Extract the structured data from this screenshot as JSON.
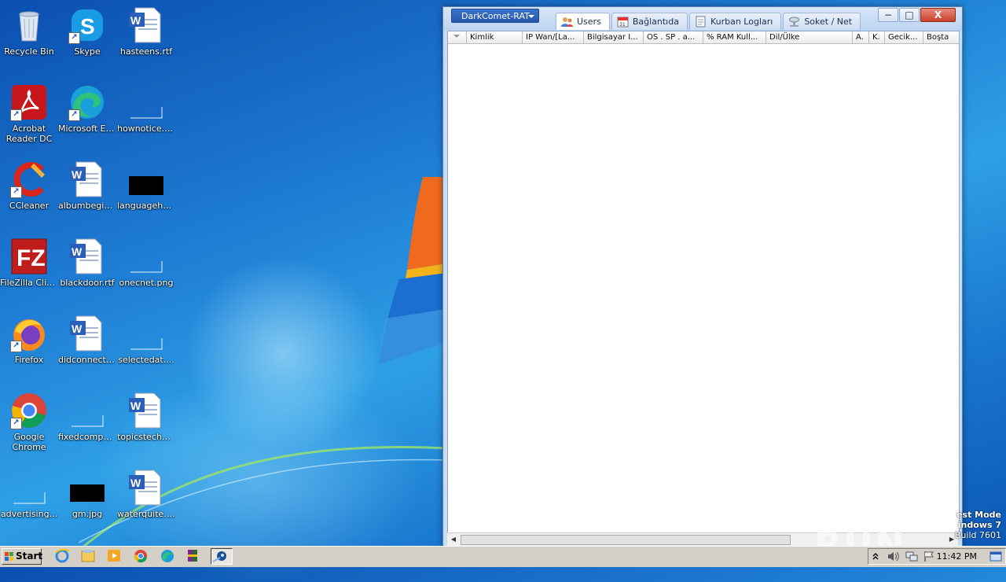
{
  "desktop": {
    "icons": [
      {
        "label": "Recycle Bin"
      },
      {
        "label": "Skype"
      },
      {
        "label": "hasteens.rtf"
      },
      {
        "label": "Acrobat Reader DC"
      },
      {
        "label": "Microsoft Edge"
      },
      {
        "label": "hownotice.png"
      },
      {
        "label": "CCleaner"
      },
      {
        "label": "albumbegin..."
      },
      {
        "label": "languagehe..."
      },
      {
        "label": "FileZilla Client"
      },
      {
        "label": "blackdoor.rtf"
      },
      {
        "label": "onecnet.png"
      },
      {
        "label": "Firefox"
      },
      {
        "label": "didconnecti..."
      },
      {
        "label": "selectedat...."
      },
      {
        "label": "Google Chrome"
      },
      {
        "label": "fixedcompa..."
      },
      {
        "label": "topicstechn..."
      },
      {
        "label": "advertising..."
      },
      {
        "label": "gm.jpg"
      },
      {
        "label": "waterquite.rtf"
      }
    ],
    "watermark": "ANY RUN",
    "test_mode": {
      "line1": "est Mode",
      "line2": "indows 7",
      "line3": "Build 7601"
    }
  },
  "window": {
    "app_menu": "DarkComet-RAT",
    "tabs": [
      {
        "label": "Users",
        "icon": "users-icon"
      },
      {
        "label": "Bağlantıda",
        "icon": "calendar-icon"
      },
      {
        "label": "Kurban Logları",
        "icon": "document-icon"
      },
      {
        "label": "Soket / Net",
        "icon": "network-icon"
      }
    ],
    "controls": {
      "minimize": "−",
      "maximize": "□",
      "close": "X"
    },
    "columns": [
      "Kimlik",
      "IP Wan/[La...",
      "Bilgisayar I...",
      "OS . SP . a...",
      "% RAM Kull...",
      "Dil/Ülke",
      "A.",
      "K.",
      "Gecik...",
      "Boşta"
    ]
  },
  "taskbar": {
    "start_label": "Start",
    "clock": "11:42 PM"
  },
  "colors": {
    "desktop_bg": "#1f7fd6",
    "titlebar": "#c9dcf3",
    "close_button": "#c8422d",
    "taskbar": "#d4d0c8"
  }
}
